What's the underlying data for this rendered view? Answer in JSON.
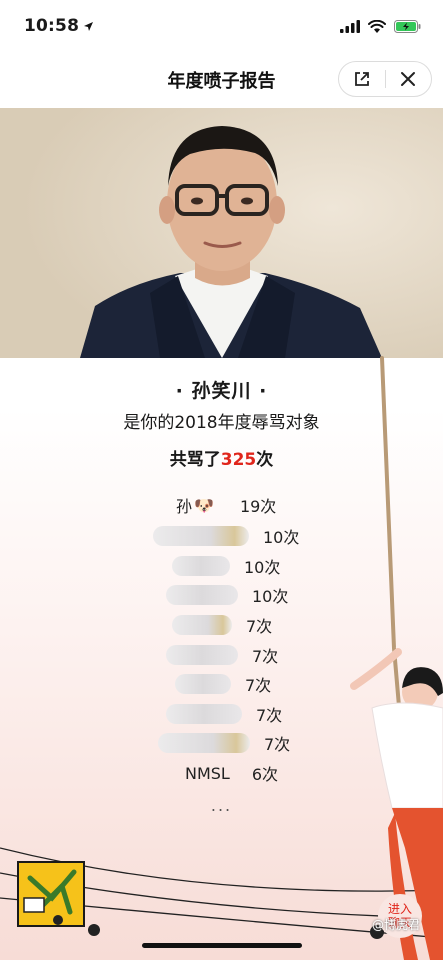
{
  "status_bar": {
    "time": "10:58",
    "location_icon": "location-arrow-icon",
    "signal_icon": "cellular-signal-icon",
    "wifi_icon": "wifi-icon",
    "battery_icon": "battery-charging-icon",
    "battery_color": "#34c759"
  },
  "nav": {
    "title": "年度喷子报告",
    "share_icon": "share-icon",
    "close_icon": "close-icon"
  },
  "report": {
    "name": "· 孙笑川 ·",
    "description": "是你的2018年度辱骂对象",
    "count_prefix": "共骂了",
    "count_value": "325",
    "count_suffix": "次",
    "accent_color": "#e0251b"
  },
  "ranking": [
    {
      "name": "孙",
      "emoji": "🐶",
      "count": "19次",
      "blurred": false
    },
    {
      "name": "",
      "count": "10次",
      "blurred": true
    },
    {
      "name": "",
      "count": "10次",
      "blurred": true
    },
    {
      "name": "",
      "count": "10次",
      "blurred": true
    },
    {
      "name": "",
      "count": "7次",
      "blurred": true
    },
    {
      "name": "",
      "count": "7次",
      "blurred": true
    },
    {
      "name": "",
      "count": "7次",
      "blurred": true
    },
    {
      "name": "",
      "count": "7次",
      "blurred": true
    },
    {
      "name": "",
      "count": "7次",
      "blurred": true
    },
    {
      "name": "NMSL",
      "count": "6次",
      "blurred": false
    }
  ],
  "more_indicator": "...",
  "enter_button": {
    "line1": "进入",
    "line2": "聊天"
  },
  "watermark": "@博虎君"
}
